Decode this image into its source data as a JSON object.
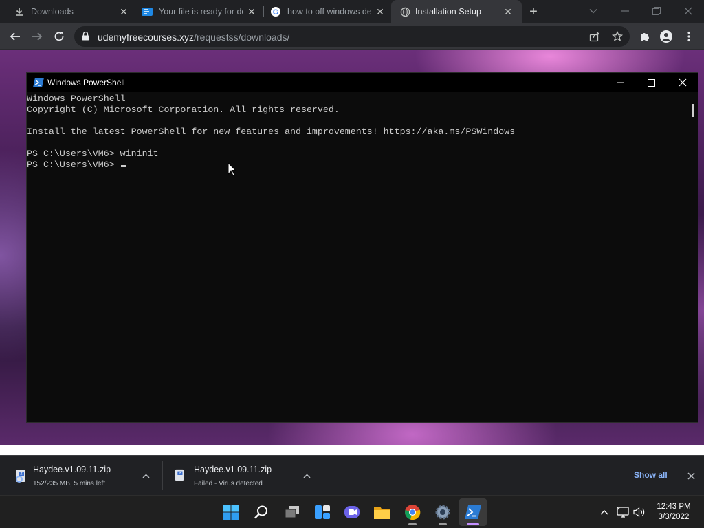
{
  "browser": {
    "tabs": [
      {
        "title": "Downloads",
        "icon": "download-icon",
        "active": false
      },
      {
        "title": "Your file is ready for do",
        "icon": "mediafire-icon",
        "active": false
      },
      {
        "title": "how to off windows de",
        "icon": "google-icon",
        "active": false
      },
      {
        "title": "Installation Setup",
        "icon": "globe-icon",
        "active": true
      }
    ],
    "new_tab_label": "+",
    "address": {
      "host": "udemyfreecourses.xyz",
      "path": "/requestss/downloads/"
    }
  },
  "powershell": {
    "title": "Windows PowerShell",
    "lines": [
      "Windows PowerShell",
      "Copyright (C) Microsoft Corporation. All rights reserved.",
      "",
      "Install the latest PowerShell for new features and improvements! https://aka.ms/PSWindows",
      "",
      "PS C:\\Users\\VM6> wininit",
      "PS C:\\Users\\VM6> "
    ]
  },
  "downloads": {
    "items": [
      {
        "name": "Haydee.v1.09.11.zip",
        "status": "152/235 MB, 5 mins left"
      },
      {
        "name": "Haydee.v1.09.11.zip",
        "status": "Failed - Virus detected"
      }
    ],
    "show_all_label": "Show all"
  },
  "taskbar": {
    "apps": [
      "start-icon",
      "search-icon",
      "task-view-icon",
      "widgets-icon",
      "teams-chat-icon",
      "file-explorer-icon",
      "chrome-icon",
      "settings-icon",
      "powershell-icon"
    ],
    "clock_time": "12:43 PM",
    "clock_date": "3/3/2022"
  },
  "colors": {
    "accent": "#8ab4f8",
    "console_bg": "#0c0c0c",
    "console_fg": "#cccccc"
  }
}
